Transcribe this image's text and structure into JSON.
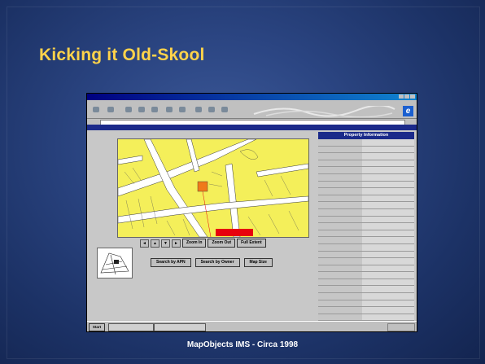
{
  "slide": {
    "title": "Kicking it Old-Skool",
    "caption": "MapObjects IMS - Circa 1998"
  },
  "screenshot": {
    "window_title": "",
    "map_tools": {
      "zoom_in": "Zoom In",
      "zoom_out": "Zoom Out",
      "full_extent": "Full Extent"
    },
    "parcel_label": "",
    "search_buttons": {
      "by_apn": "Search by APN",
      "by_owner": "Search by Owner",
      "map_size": "Map Size"
    },
    "panel_title": "Property Information",
    "property_rows": [
      {
        "key": "",
        "value": ""
      },
      {
        "key": "",
        "value": ""
      },
      {
        "key": "",
        "value": ""
      },
      {
        "key": "",
        "value": ""
      },
      {
        "key": "",
        "value": ""
      },
      {
        "key": "",
        "value": ""
      },
      {
        "key": "",
        "value": ""
      },
      {
        "key": "",
        "value": ""
      },
      {
        "key": "",
        "value": ""
      },
      {
        "key": "",
        "value": ""
      },
      {
        "key": "",
        "value": ""
      },
      {
        "key": "",
        "value": ""
      },
      {
        "key": "",
        "value": ""
      },
      {
        "key": "",
        "value": ""
      },
      {
        "key": "",
        "value": ""
      },
      {
        "key": "",
        "value": ""
      },
      {
        "key": "",
        "value": ""
      },
      {
        "key": "",
        "value": ""
      },
      {
        "key": "",
        "value": ""
      },
      {
        "key": "",
        "value": ""
      },
      {
        "key": "",
        "value": ""
      },
      {
        "key": "",
        "value": ""
      },
      {
        "key": "",
        "value": ""
      },
      {
        "key": "",
        "value": ""
      },
      {
        "key": "",
        "value": ""
      },
      {
        "key": "",
        "value": ""
      },
      {
        "key": "",
        "value": ""
      }
    ],
    "taskbar": {
      "start": "Start",
      "tasks": [
        "",
        ""
      ]
    }
  },
  "colors": {
    "title": "#ffd34a",
    "nav_bar": "#1b2a8a",
    "map_fill": "#f4ef5a",
    "parcel_label": "#e8000d"
  }
}
